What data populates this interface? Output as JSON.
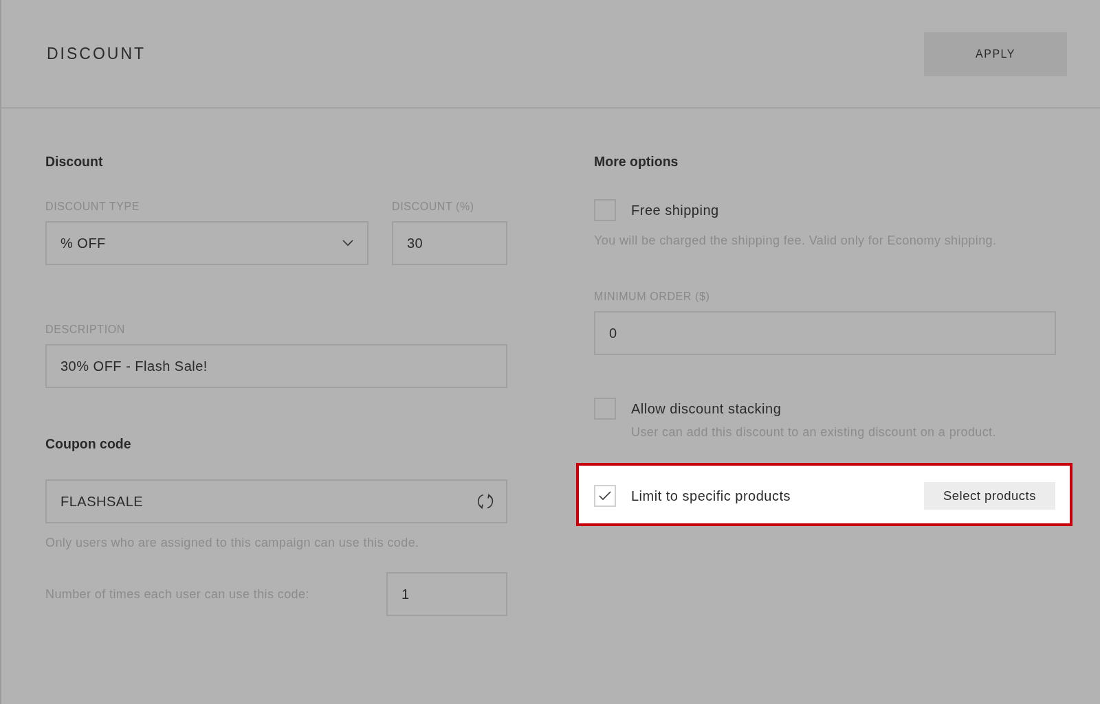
{
  "header": {
    "title": "DISCOUNT",
    "apply_button": "APPLY"
  },
  "discount": {
    "heading": "Discount",
    "type_field": {
      "label": "DISCOUNT TYPE",
      "value": "% OFF"
    },
    "percent_field": {
      "label": "DISCOUNT (%)",
      "value": "30"
    },
    "description_field": {
      "label": "DESCRIPTION",
      "value": "30% OFF - Flash Sale!"
    }
  },
  "coupon": {
    "heading": "Coupon code",
    "code": "FLASHSALE",
    "hint": "Only users who are assigned to this campaign can use this code.",
    "uses_label": "Number of times each user can use this code:",
    "uses_value": "1"
  },
  "more_options": {
    "heading": "More options",
    "items": [
      {
        "kind": "checkbox",
        "label": "Free shipping",
        "checked": false,
        "highlighted": false,
        "hint": "You will be charged the shipping fee. Valid only for Economy shipping."
      },
      {
        "kind": "field",
        "label": "MINIMUM ORDER ($)",
        "value": "0"
      },
      {
        "kind": "checkbox",
        "label": "Allow discount stacking",
        "checked": false,
        "highlighted": false,
        "hint": "User can add this discount to an existing discount on a product."
      },
      {
        "kind": "checkbox",
        "label": "Limit to specific products",
        "checked": true,
        "highlighted": true,
        "button": "Select products"
      }
    ]
  }
}
